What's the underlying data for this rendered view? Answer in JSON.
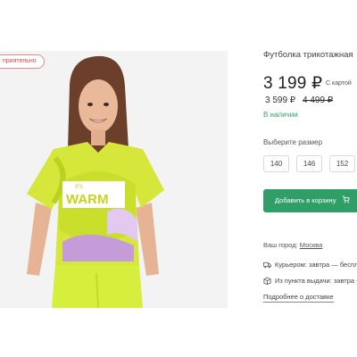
{
  "photo": {
    "badge": "приятельно",
    "shirt_print": {
      "small": "It's",
      "big": "WARM"
    }
  },
  "product": {
    "title": "Футболка трикотажная",
    "price": "3 199 ₽",
    "card_note": "С картой",
    "old_price": "3 599 ₽",
    "crossed_price": "4 499 ₽",
    "stock": "В наличии"
  },
  "sizes": {
    "label": "Выберите размер",
    "options": [
      "140",
      "146",
      "152"
    ]
  },
  "cart": {
    "label": "Добавить в корзину"
  },
  "delivery": {
    "city_label": "Ваш город:",
    "city": "Москва",
    "courier": "Курьером: завтра — беспл",
    "pickup": "Из пункта выдачи: завтра -",
    "more": "Подробнее о доставке"
  },
  "colors": {
    "accent": "#2f9e67",
    "stock": "#2e9f63",
    "badge": "#d24b4b"
  }
}
